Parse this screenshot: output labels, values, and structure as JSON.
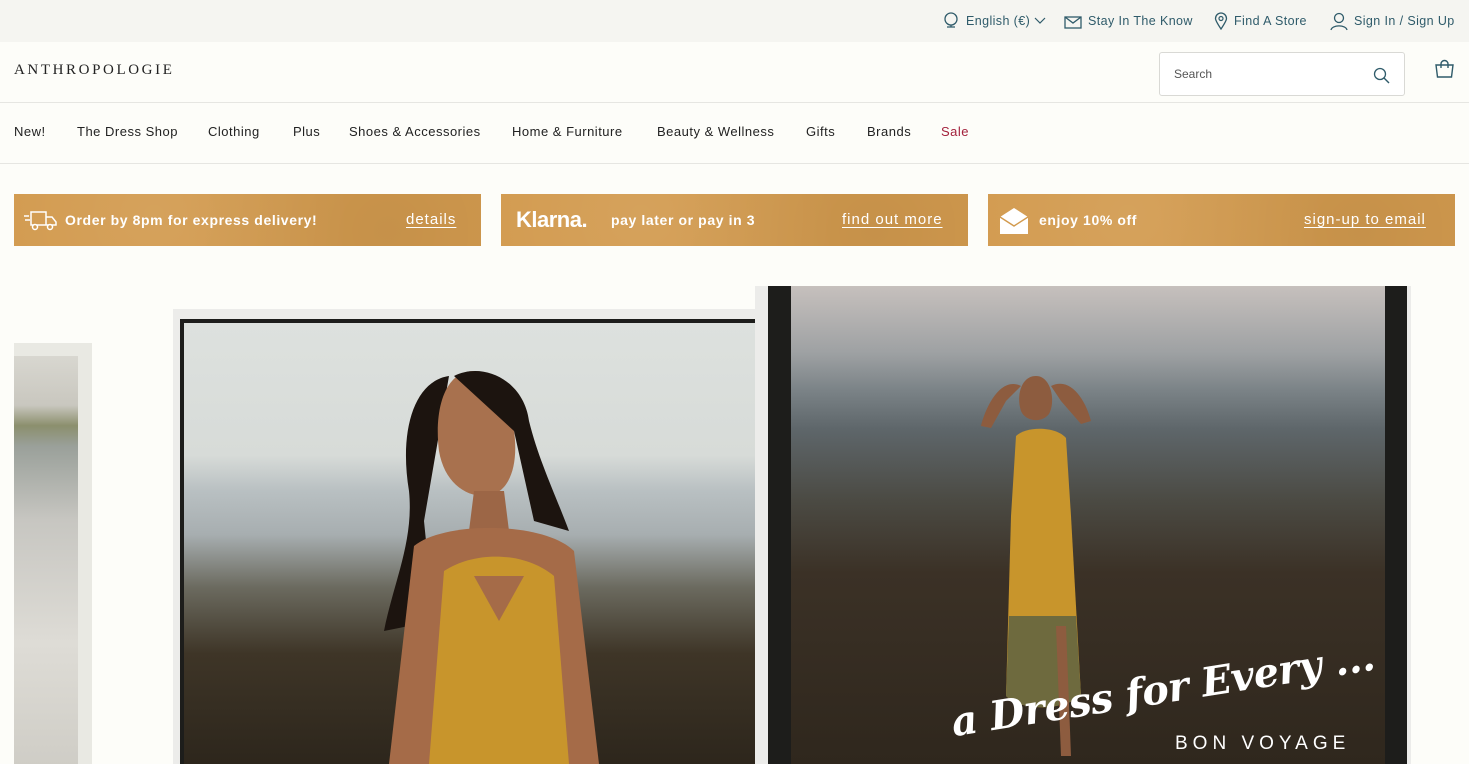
{
  "utility": {
    "language": "English (€)",
    "newsletter": "Stay In The Know",
    "store": "Find A Store",
    "signin": "Sign In / Sign Up"
  },
  "header": {
    "logo": "ANTHROPOLOGIE",
    "search_placeholder": "Search"
  },
  "nav": {
    "items": [
      "New!",
      "The Dress Shop",
      "Clothing",
      "Plus",
      "Shoes & Accessories",
      "Home & Furniture",
      "Beauty & Wellness",
      "Gifts",
      "Brands",
      "Sale"
    ]
  },
  "promos": [
    {
      "text": "Order by 8pm for express delivery!",
      "link": "details"
    },
    {
      "logo": "Klarna.",
      "text": "pay later or pay in 3",
      "link": "find out more"
    },
    {
      "text": "enjoy 10% off",
      "link": "sign-up to email"
    }
  ],
  "hero": {
    "script": "a Dress for Every ...",
    "caption": "BON VOYAGE"
  },
  "colors": {
    "accent": "#2f5b6a",
    "promo": "#d29a4e",
    "sale": "#a3213c"
  }
}
